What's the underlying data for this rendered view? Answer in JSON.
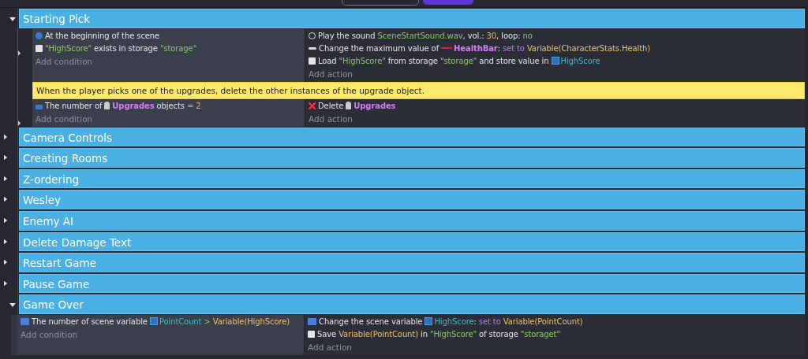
{
  "groups": [
    {
      "title": "Starting Pick",
      "expanded": true,
      "events": [
        {
          "kind": "event",
          "conditions": [
            {
              "kind": "scene",
              "parts": [
                {
                  "kind": "text",
                  "t": "At the beginning of the scene"
                }
              ]
            },
            {
              "kind": "storage",
              "parts": [
                {
                  "kind": "string",
                  "t": "\"HighScore\""
                },
                {
                  "kind": "text",
                  "t": "exists in storage"
                },
                {
                  "kind": "string",
                  "t": "\"storage\""
                }
              ]
            }
          ],
          "add_condition": "Add condition",
          "actions": [
            {
              "kind": "sound",
              "parts": [
                {
                  "kind": "text",
                  "t": "Play the sound"
                },
                {
                  "kind": "string",
                  "t": "SceneStartSound.wav"
                },
                {
                  "kind": "text",
                  "t": ", vol.:",
                  "join": true
                },
                {
                  "kind": "number",
                  "t": "30"
                },
                {
                  "kind": "text",
                  "t": ", loop:",
                  "join": true
                },
                {
                  "kind": "string",
                  "t": "no"
                }
              ]
            },
            {
              "kind": "bar",
              "parts": [
                {
                  "kind": "text",
                  "t": "Change the maximum value of"
                },
                {
                  "kind": "bar",
                  "t": "HealthBar"
                },
                {
                  "kind": "text",
                  "t": ":",
                  "join": true
                },
                {
                  "kind": "keyword",
                  "t": "set to"
                },
                {
                  "kind": "expr",
                  "t": "Variable(CharacterStats.Health)"
                }
              ]
            },
            {
              "kind": "storage",
              "parts": [
                {
                  "kind": "text",
                  "t": "Load"
                },
                {
                  "kind": "string",
                  "t": "\"HighScore\""
                },
                {
                  "kind": "text",
                  "t": "from storage"
                },
                {
                  "kind": "string",
                  "t": "\"storage\""
                },
                {
                  "kind": "text",
                  "t": "and store value in"
                },
                {
                  "kind": "variable",
                  "t": "HighScore"
                }
              ]
            }
          ],
          "add_action": "Add action"
        },
        {
          "kind": "comment",
          "text": "When the player picks one of the upgrades, delete the other instances of the upgrade object."
        },
        {
          "kind": "event",
          "conditions": [
            {
              "kind": "objects",
              "parts": [
                {
                  "kind": "text",
                  "t": "The number of"
                },
                {
                  "kind": "object",
                  "t": "Upgrades"
                },
                {
                  "kind": "text",
                  "t": "objects"
                },
                {
                  "kind": "op",
                  "t": "="
                },
                {
                  "kind": "number",
                  "t": "2"
                }
              ]
            }
          ],
          "add_condition": "Add condition",
          "actions": [
            {
              "kind": "delete",
              "parts": [
                {
                  "kind": "text",
                  "t": "Delete"
                },
                {
                  "kind": "object",
                  "t": "Upgrades"
                }
              ]
            }
          ],
          "add_action": "Add action"
        }
      ]
    },
    {
      "title": "Camera Controls",
      "expanded": false
    },
    {
      "title": "Creating Rooms",
      "expanded": false
    },
    {
      "title": "Z-ordering",
      "expanded": false
    },
    {
      "title": "Wesley",
      "expanded": false
    },
    {
      "title": "Enemy AI",
      "expanded": false
    },
    {
      "title": "Delete Damage Text",
      "expanded": false
    },
    {
      "title": "Restart Game",
      "expanded": false
    },
    {
      "title": "Pause Game",
      "expanded": false
    },
    {
      "title": "Game Over",
      "expanded": true,
      "events": [
        {
          "kind": "event",
          "conditions": [
            {
              "kind": "variable",
              "parts": [
                {
                  "kind": "text",
                  "t": "The number of scene variable"
                },
                {
                  "kind": "variable",
                  "t": "PointCount"
                },
                {
                  "kind": "op",
                  "t": ">"
                },
                {
                  "kind": "expr",
                  "t": "Variable(HighScore)"
                }
              ]
            }
          ],
          "add_condition": "Add condition",
          "actions": [
            {
              "kind": "variable",
              "parts": [
                {
                  "kind": "text",
                  "t": "Change the scene variable"
                },
                {
                  "kind": "variable",
                  "t": "HighScore"
                },
                {
                  "kind": "text",
                  "t": ":",
                  "join": true
                },
                {
                  "kind": "keyword",
                  "t": "set to"
                },
                {
                  "kind": "expr",
                  "t": "Variable(PointCount)"
                }
              ]
            },
            {
              "kind": "storage",
              "parts": [
                {
                  "kind": "text",
                  "t": "Save"
                },
                {
                  "kind": "expr",
                  "t": "Variable(PointCount)"
                },
                {
                  "kind": "text",
                  "t": "in"
                },
                {
                  "kind": "string",
                  "t": "\"HighScore\""
                },
                {
                  "kind": "text",
                  "t": "of storage"
                },
                {
                  "kind": "string",
                  "t": "\"storaget\""
                }
              ]
            }
          ],
          "add_action": "Add action"
        }
      ]
    }
  ]
}
